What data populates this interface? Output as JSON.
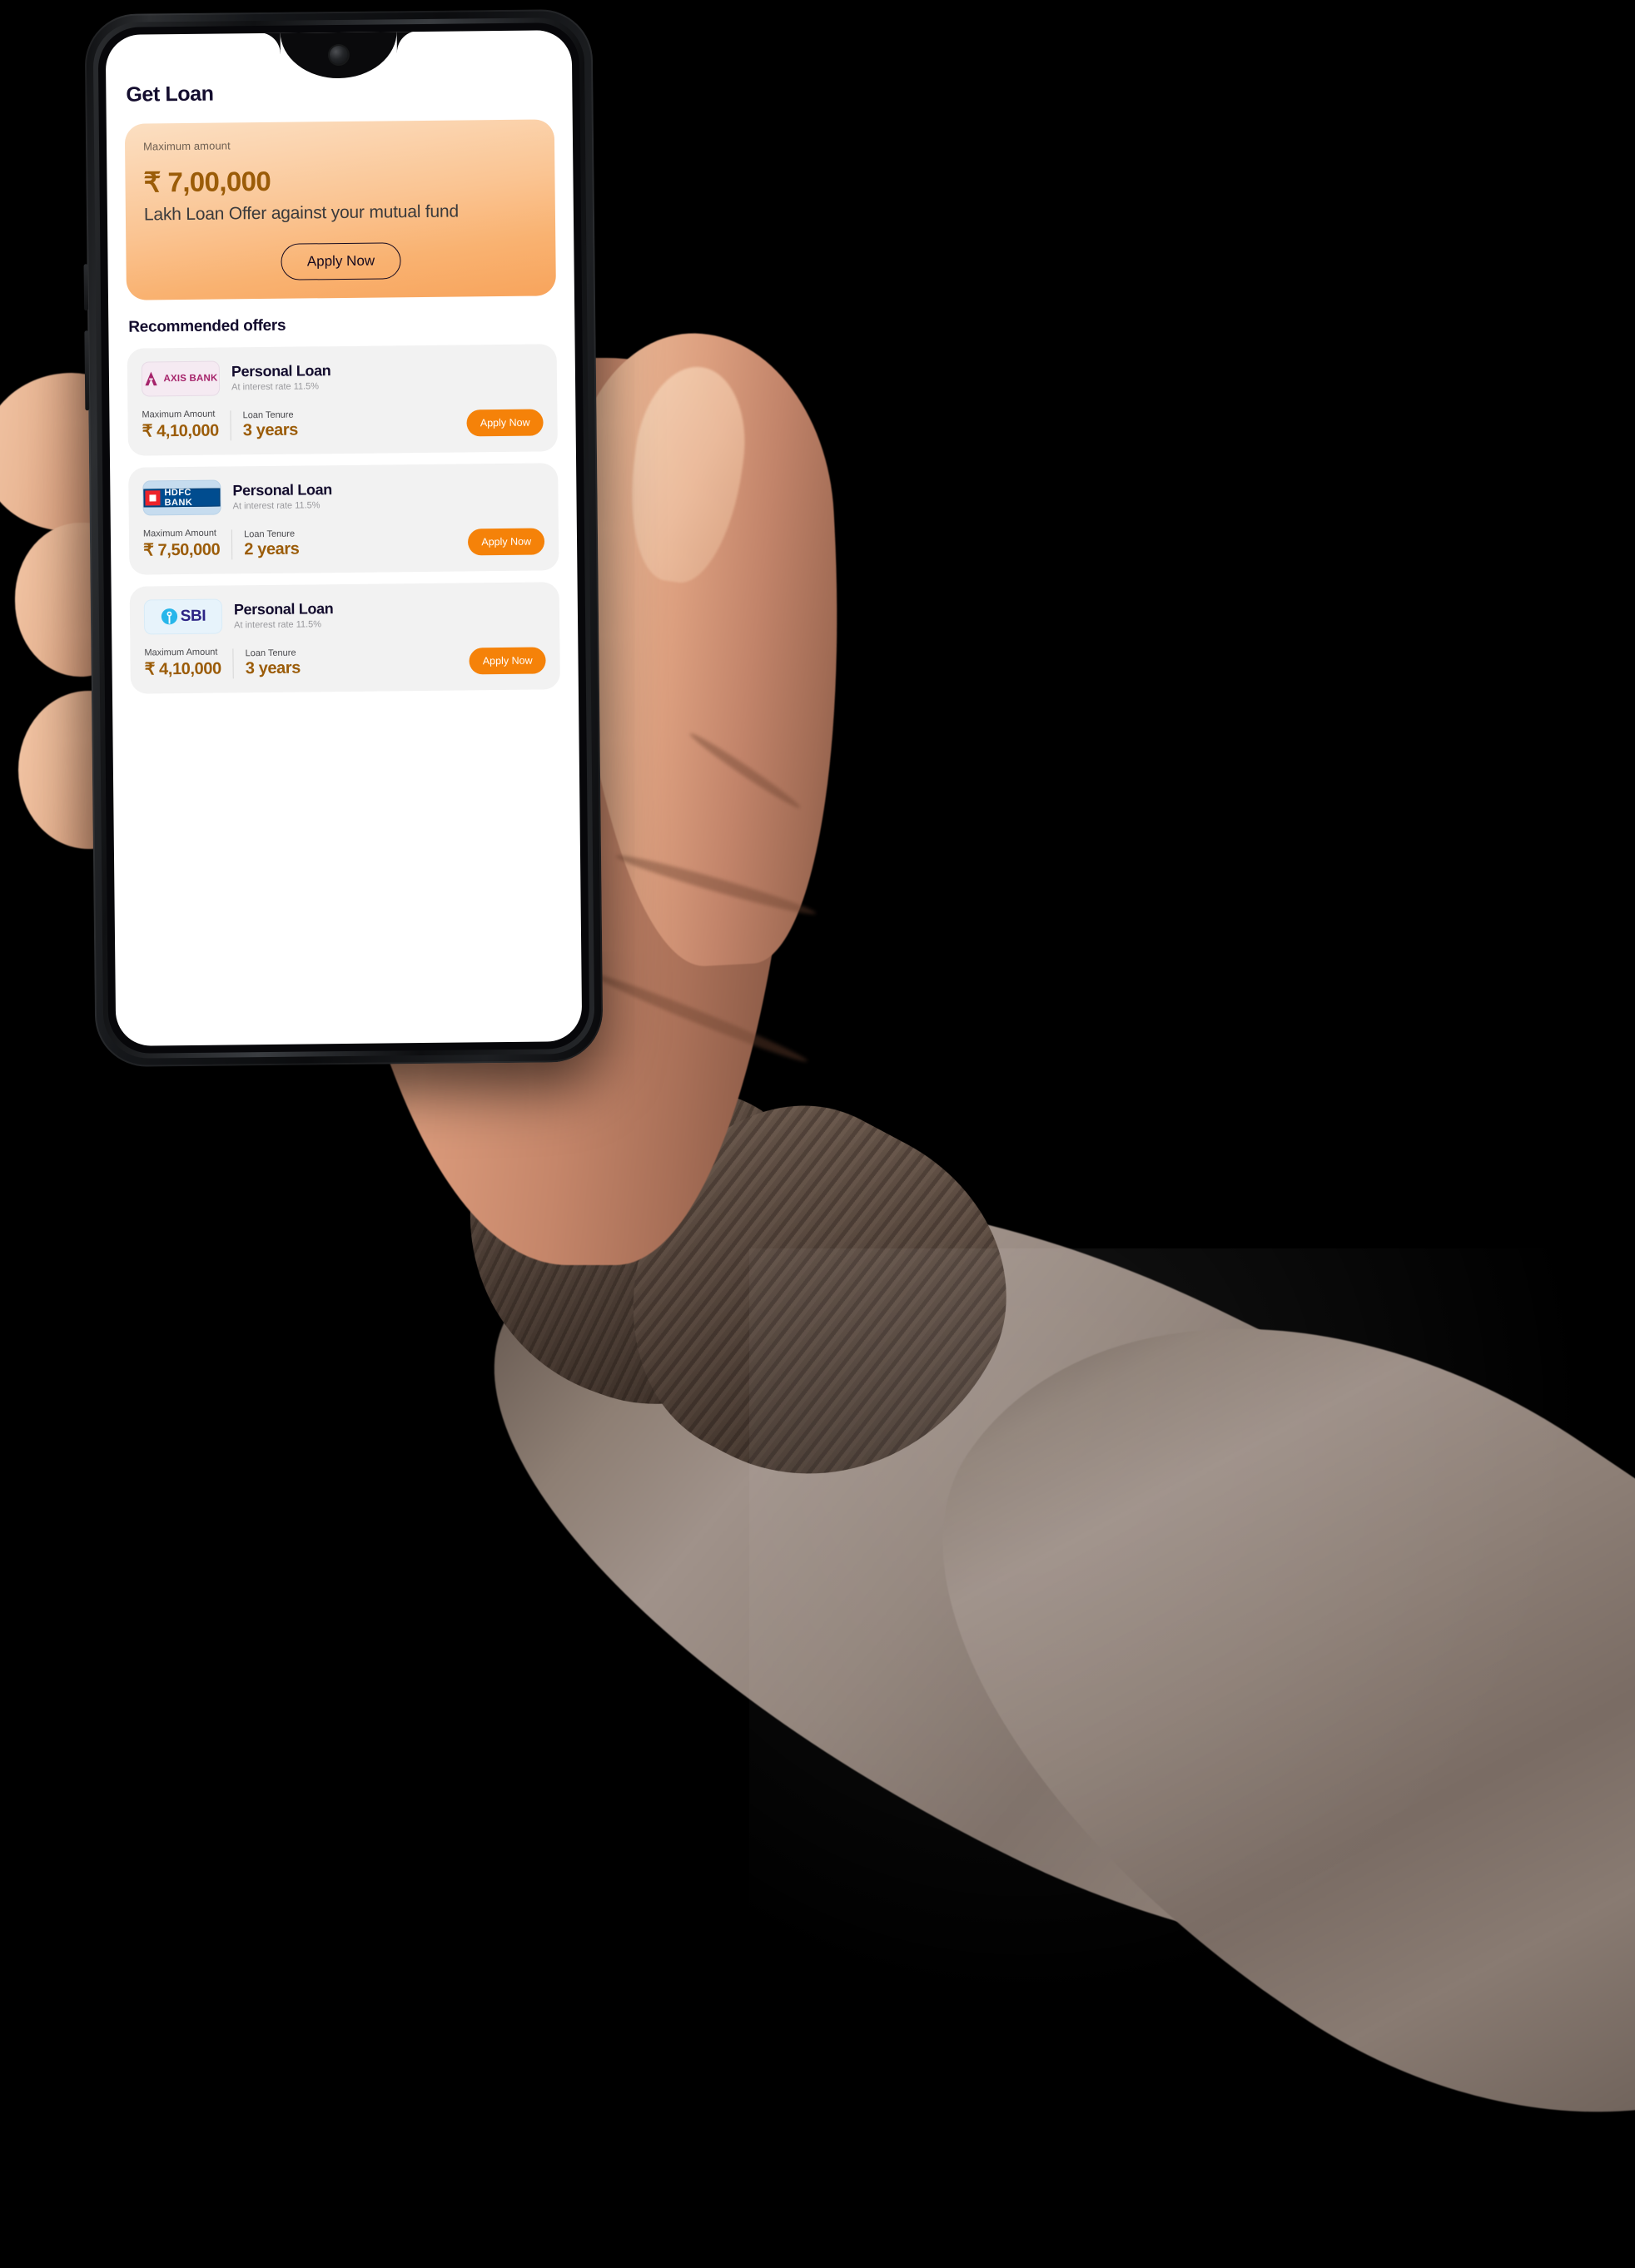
{
  "app": {
    "page_title": "Get Loan",
    "hero": {
      "label": "Maximum amount",
      "amount": "₹ 7,00,000",
      "subtitle": "Lakh Loan Offer against your mutual fund",
      "cta_label": "Apply Now"
    },
    "section_title": "Recommended offers",
    "labels": {
      "max_amount": "Maximum Amount",
      "loan_tenure": "Loan Tenure",
      "apply": "Apply Now"
    },
    "offers": [
      {
        "bank": "AXIS BANK",
        "bank_key": "axis",
        "title": "Personal Loan",
        "rate": "At interest rate 11.5%",
        "max_amount_label": "Maximum Amount",
        "max_amount": "₹ 4,10,000",
        "tenure_label": "Loan Tenure",
        "tenure": "3 years",
        "apply": "Apply Now"
      },
      {
        "bank": "HDFC BANK",
        "bank_key": "hdfc",
        "title": "Personal Loan",
        "rate": "At interest rate 11.5%",
        "max_amount_label": "Maximum Amount",
        "max_amount": "₹ 7,50,000",
        "tenure_label": "Loan Tenure",
        "tenure": "2 years",
        "apply": "Apply Now"
      },
      {
        "bank": "SBI",
        "bank_key": "sbi",
        "title": "Personal Loan",
        "rate": "At interest rate 11.5%",
        "max_amount_label": "Maximum Amount",
        "max_amount": "₹ 4,10,000",
        "tenure_label": "Loan Tenure",
        "tenure": "3 years",
        "apply": "Apply Now"
      }
    ]
  },
  "colors": {
    "background": "#000000",
    "accent_orange": "#f58209",
    "amount_brown": "#9b5c08",
    "title_ink": "#140d2e",
    "card_grey": "#f2f2f2",
    "hero_gradient_top": "#fbdfc2",
    "hero_gradient_bottom": "#f8a45c",
    "axis_magenta": "#a6246b",
    "hdfc_blue": "#004c8f",
    "hdfc_red": "#ed232a",
    "sbi_cyan": "#27b6ea",
    "sbi_purple": "#2e2585",
    "sleeve_taupe": "#8e8077",
    "skin": "#e6ab88"
  }
}
